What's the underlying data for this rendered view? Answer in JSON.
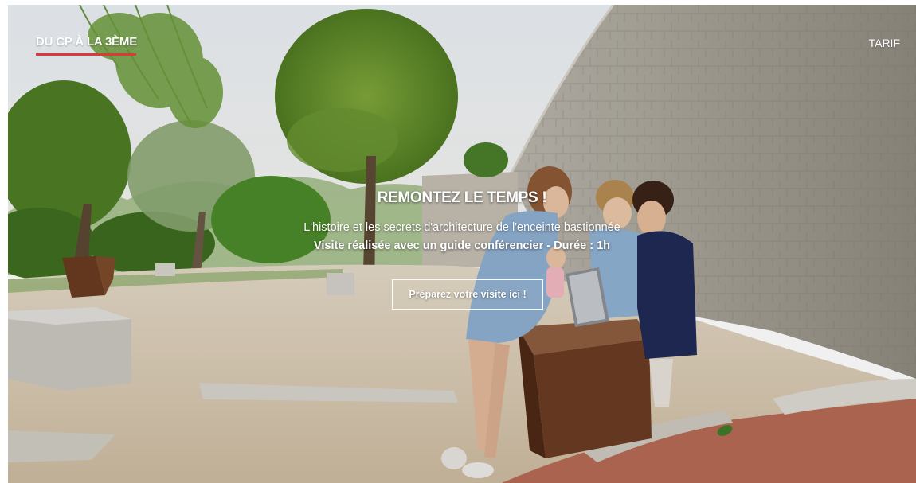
{
  "nav": {
    "left_label": "DU CP À LA 3ÈME",
    "right_label": "TARIF",
    "accent_color": "#e0363d"
  },
  "hero": {
    "title": "REMONTEZ LE TEMPS !",
    "subtitle": "L'histoire et les secrets d'architecture de l'enceinte bastionnée",
    "info": "Visite réalisée avec un guide conférencier - Durée : 1h",
    "cta_label": "Préparez votre visite ici !"
  }
}
